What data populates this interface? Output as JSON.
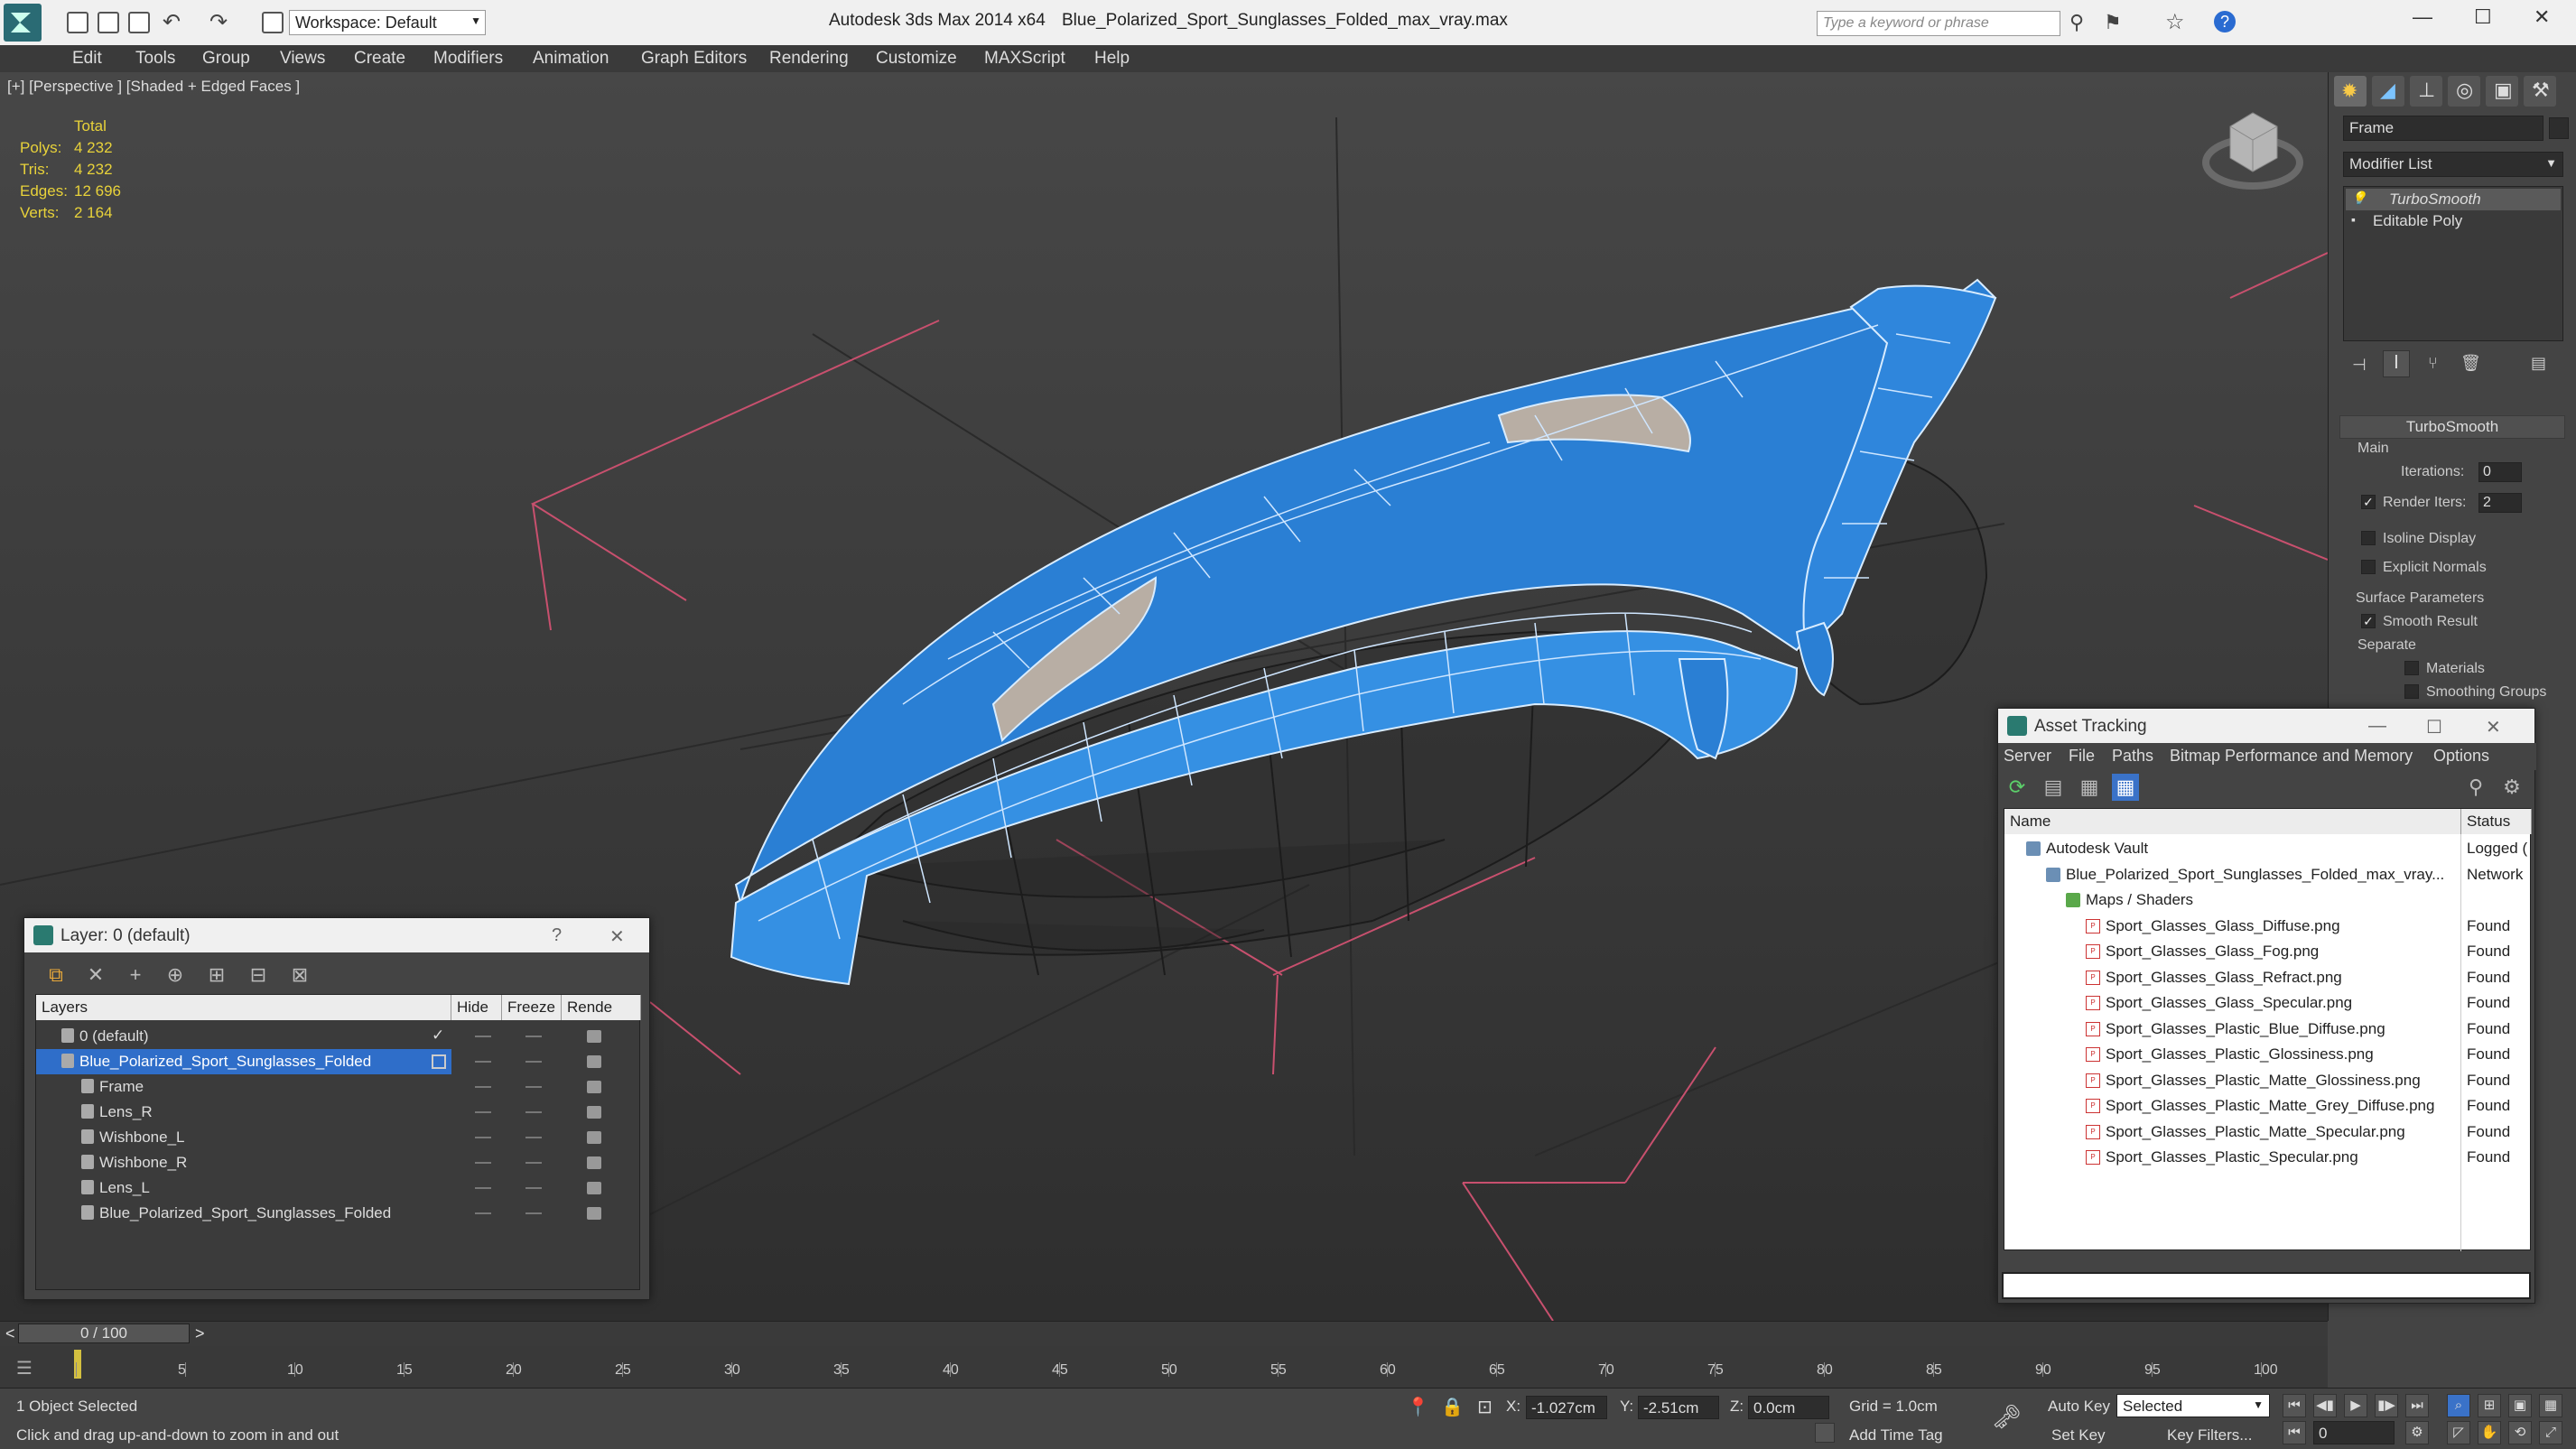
{
  "titlebar": {
    "app": "Autodesk 3ds Max  2014 x64",
    "file": "Blue_Polarized_Sport_Sunglasses_Folded_max_vray.max",
    "workspace": "Workspace: Default",
    "search_placeholder": "Type a keyword or phrase"
  },
  "menu": [
    "Edit",
    "Tools",
    "Group",
    "Views",
    "Create",
    "Modifiers",
    "Animation",
    "Graph Editors",
    "Rendering",
    "Customize",
    "MAXScript",
    "Help"
  ],
  "viewport": {
    "label": "[+] [Perspective ] [Shaded + Edged Faces ]",
    "stats": {
      "header": "Total",
      "rows": [
        {
          "k": "Polys:",
          "v": "4 232"
        },
        {
          "k": "Tris:",
          "v": "4 232"
        },
        {
          "k": "Edges:",
          "v": "12 696"
        },
        {
          "k": "Verts:",
          "v": "2 164"
        }
      ]
    }
  },
  "command_panel": {
    "object_name": "Frame",
    "modifier_list": "Modifier List",
    "stack": [
      "TurboSmooth",
      "Editable Poly"
    ],
    "rollout_title": "TurboSmooth",
    "main_label": "Main",
    "iterations_label": "Iterations:",
    "iterations_value": "0",
    "render_iters_label": "Render Iters:",
    "render_iters_value": "2",
    "isoline_label": "Isoline Display",
    "explicit_normals_label": "Explicit Normals",
    "surface_params_label": "Surface Parameters",
    "smooth_result_label": "Smooth Result",
    "separate_label": "Separate",
    "materials_label": "Materials",
    "smoothing_groups_label": "Smoothing Groups",
    "check_mark": "✓"
  },
  "layer_window": {
    "title": "Layer: 0 (default)",
    "help": "?",
    "close": "✕",
    "tools": [
      "⧉",
      "✕",
      "+",
      "⊕",
      "⊞",
      "⊟",
      "⊠"
    ],
    "columns": [
      "Layers",
      "Hide",
      "Freeze",
      "Rende"
    ],
    "rows": [
      {
        "name": "0 (default)",
        "indent": 1,
        "check": "✓"
      },
      {
        "name": "Blue_Polarized_Sport_Sunglasses_Folded",
        "indent": 1,
        "selected": true
      },
      {
        "name": "Frame",
        "indent": 2
      },
      {
        "name": "Lens_R",
        "indent": 2
      },
      {
        "name": "Wishbone_L",
        "indent": 2
      },
      {
        "name": "Wishbone_R",
        "indent": 2
      },
      {
        "name": "Lens_L",
        "indent": 2
      },
      {
        "name": "Blue_Polarized_Sport_Sunglasses_Folded",
        "indent": 2
      }
    ]
  },
  "asset_window": {
    "title": "Asset Tracking",
    "min": "—",
    "max": "☐",
    "close": "✕",
    "menu": [
      "Server",
      "File",
      "Paths",
      "Bitmap Performance and Memory",
      "Options"
    ],
    "columns": [
      "Name",
      "Status"
    ],
    "rows": [
      {
        "name": "Autodesk Vault",
        "status": "Logged (",
        "indent": 0,
        "icon": "vault-icon"
      },
      {
        "name": "Blue_Polarized_Sport_Sunglasses_Folded_max_vray...",
        "status": "Network",
        "indent": 1,
        "icon": "max-file-icon"
      },
      {
        "name": "Maps / Shaders",
        "status": "",
        "indent": 2,
        "icon": "maps-folder-icon"
      },
      {
        "name": "Sport_Glasses_Glass_Diffuse.png",
        "status": "Found",
        "indent": 3,
        "icon": "png-icon"
      },
      {
        "name": "Sport_Glasses_Glass_Fog.png",
        "status": "Found",
        "indent": 3,
        "icon": "png-icon"
      },
      {
        "name": "Sport_Glasses_Glass_Refract.png",
        "status": "Found",
        "indent": 3,
        "icon": "png-icon"
      },
      {
        "name": "Sport_Glasses_Glass_Specular.png",
        "status": "Found",
        "indent": 3,
        "icon": "png-icon"
      },
      {
        "name": "Sport_Glasses_Plastic_Blue_Diffuse.png",
        "status": "Found",
        "indent": 3,
        "icon": "png-icon"
      },
      {
        "name": "Sport_Glasses_Plastic_Glossiness.png",
        "status": "Found",
        "indent": 3,
        "icon": "png-icon"
      },
      {
        "name": "Sport_Glasses_Plastic_Matte_Glossiness.png",
        "status": "Found",
        "indent": 3,
        "icon": "png-icon"
      },
      {
        "name": "Sport_Glasses_Plastic_Matte_Grey_Diffuse.png",
        "status": "Found",
        "indent": 3,
        "icon": "png-icon"
      },
      {
        "name": "Sport_Glasses_Plastic_Matte_Specular.png",
        "status": "Found",
        "indent": 3,
        "icon": "png-icon"
      },
      {
        "name": "Sport_Glasses_Plastic_Specular.png",
        "status": "Found",
        "indent": 3,
        "icon": "png-icon"
      }
    ]
  },
  "timeline": {
    "frame": "0 / 100",
    "prev": "<",
    "next": ">",
    "ticks": [
      "0",
      "5",
      "10",
      "15",
      "20",
      "25",
      "30",
      "35",
      "40",
      "45",
      "50",
      "55",
      "60",
      "65",
      "70",
      "75",
      "80",
      "85",
      "90",
      "95",
      "100"
    ]
  },
  "status": {
    "selected": "1 Object Selected",
    "prompt": "Click and drag up-and-down to zoom in and out",
    "x_label": "X:",
    "x": "-1.027cm",
    "y_label": "Y:",
    "y": "-2.51cm",
    "z_label": "Z:",
    "z": "0.0cm",
    "grid": "Grid = 1.0cm",
    "add_time_tag": "Add Time Tag",
    "auto_key": "Auto Key",
    "set_key": "Set Key",
    "selected_dropdown": "Selected",
    "key_filters": "Key Filters...",
    "frame_value": "0"
  },
  "colors": {
    "accent": "#2f6ec9",
    "model_blue": "#2a7fd4",
    "stats_yellow": "#e8d23a",
    "grid_pink": "#c8506e"
  }
}
